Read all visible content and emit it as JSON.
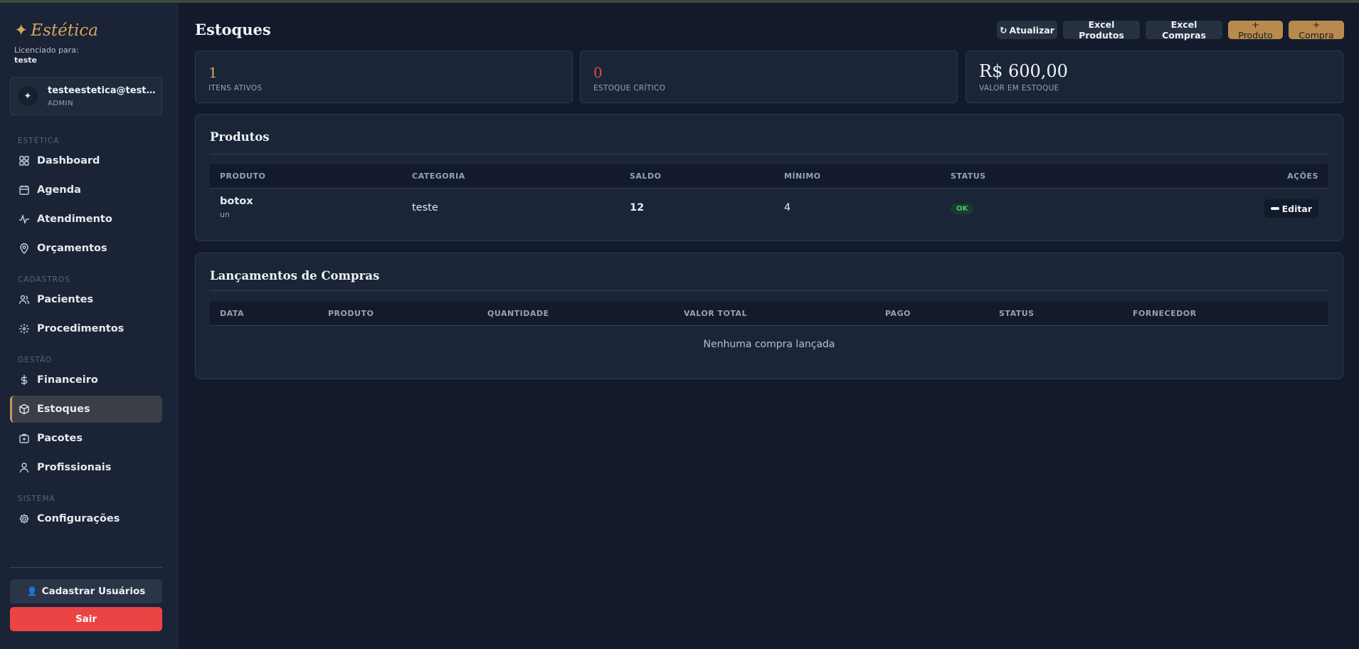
{
  "sidebar": {
    "brand": "Estética",
    "licensed_label": "Licenciado para:",
    "licensed_name": "teste",
    "user": {
      "email": "testeestetica@teste.com",
      "role": "ADMIN"
    },
    "sections": [
      {
        "title": "ESTÉTICA",
        "items": [
          "Dashboard",
          "Agenda",
          "Atendimento",
          "Orçamentos"
        ]
      },
      {
        "title": "CADASTROS",
        "items": [
          "Pacientes",
          "Procedimentos"
        ]
      },
      {
        "title": "GESTÃO",
        "items": [
          "Financeiro",
          "Estoques",
          "Pacotes",
          "Profissionais"
        ]
      },
      {
        "title": "SISTEMA",
        "items": [
          "Configurações"
        ]
      }
    ],
    "active_item": "Estoques",
    "register_button": "Cadastrar Usuários",
    "exit_button": "Sair",
    "accent_color": "#c59a5a",
    "exit_color": "#ec4444"
  },
  "header": {
    "title": "Estoques",
    "buttons": {
      "refresh": "Atualizar",
      "excel_products": "Excel Produtos",
      "excel_purchases": "Excel Compras",
      "add_product": "+ Produto",
      "add_purchase": "+ Compra"
    }
  },
  "stats": [
    {
      "value": "1",
      "label": "ITENS ATIVOS",
      "color": "#d4a55c"
    },
    {
      "value": "0",
      "label": "ESTOQUE CRÍTICO",
      "color": "#e5484d"
    },
    {
      "value": "R$ 600,00",
      "label": "VALOR EM ESTOQUE",
      "color": "#f0f2f5"
    }
  ],
  "products": {
    "title": "Produtos",
    "columns": [
      "PRODUTO",
      "CATEGORIA",
      "SALDO",
      "MÍNIMO",
      "STATUS",
      "AÇÕES"
    ],
    "rows": [
      {
        "name": "botox",
        "unit": "un",
        "category": "teste",
        "balance": "12",
        "minimum": "4",
        "status": "OK",
        "action": "Editar"
      }
    ]
  },
  "purchases": {
    "title": "Lançamentos de Compras",
    "columns": [
      "DATA",
      "PRODUTO",
      "QUANTIDADE",
      "VALOR TOTAL",
      "PAGO",
      "STATUS",
      "FORNECEDOR"
    ],
    "empty_message": "Nenhuma compra lançada"
  }
}
